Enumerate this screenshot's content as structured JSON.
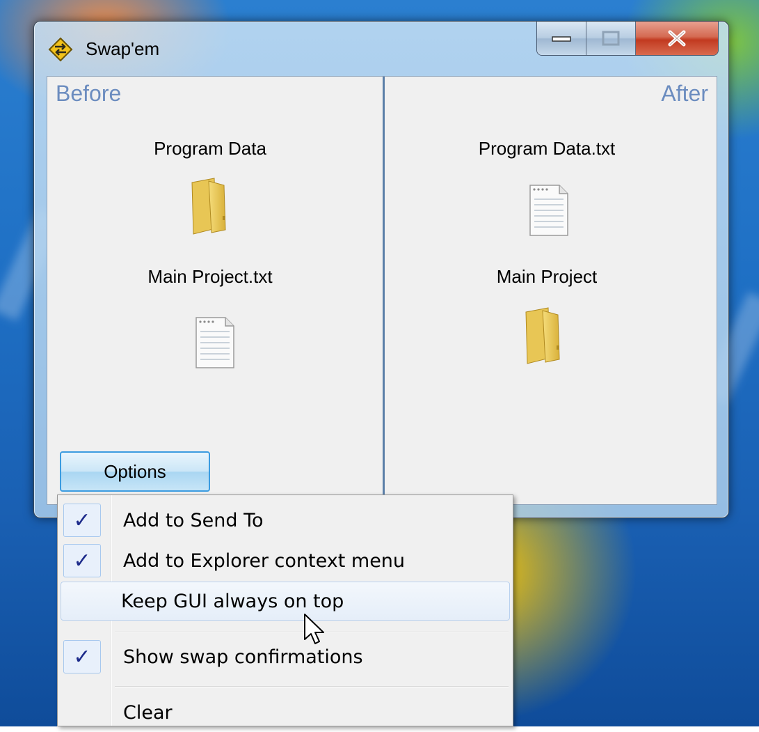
{
  "window": {
    "title": "Swap'em",
    "caption_buttons": [
      "minimize",
      "maximize",
      "close"
    ]
  },
  "before": {
    "heading": "Before",
    "items": [
      {
        "label": "Program Data",
        "icon": "folder-icon"
      },
      {
        "label": "Main Project.txt",
        "icon": "text-file-icon"
      }
    ]
  },
  "after": {
    "heading": "After",
    "items": [
      {
        "label": "Program Data.txt",
        "icon": "text-file-icon"
      },
      {
        "label": "Main Project",
        "icon": "folder-icon"
      }
    ]
  },
  "options_button": {
    "label": "Options"
  },
  "menu": {
    "items": [
      {
        "label": "Add to Send To",
        "checked": true
      },
      {
        "label": "Add to Explorer context menu",
        "checked": true
      },
      {
        "label": "Keep GUI always on top",
        "checked": false,
        "hovered": true
      },
      {
        "label": "Show swap confirmations",
        "checked": true
      },
      {
        "label": "Clear",
        "checked": false
      }
    ]
  },
  "colors": {
    "heading_blue": "#6b8cbf",
    "divider_blue": "#5b7fa8",
    "close_red": "#c23a20",
    "check_blue": "#1c2a8a"
  }
}
